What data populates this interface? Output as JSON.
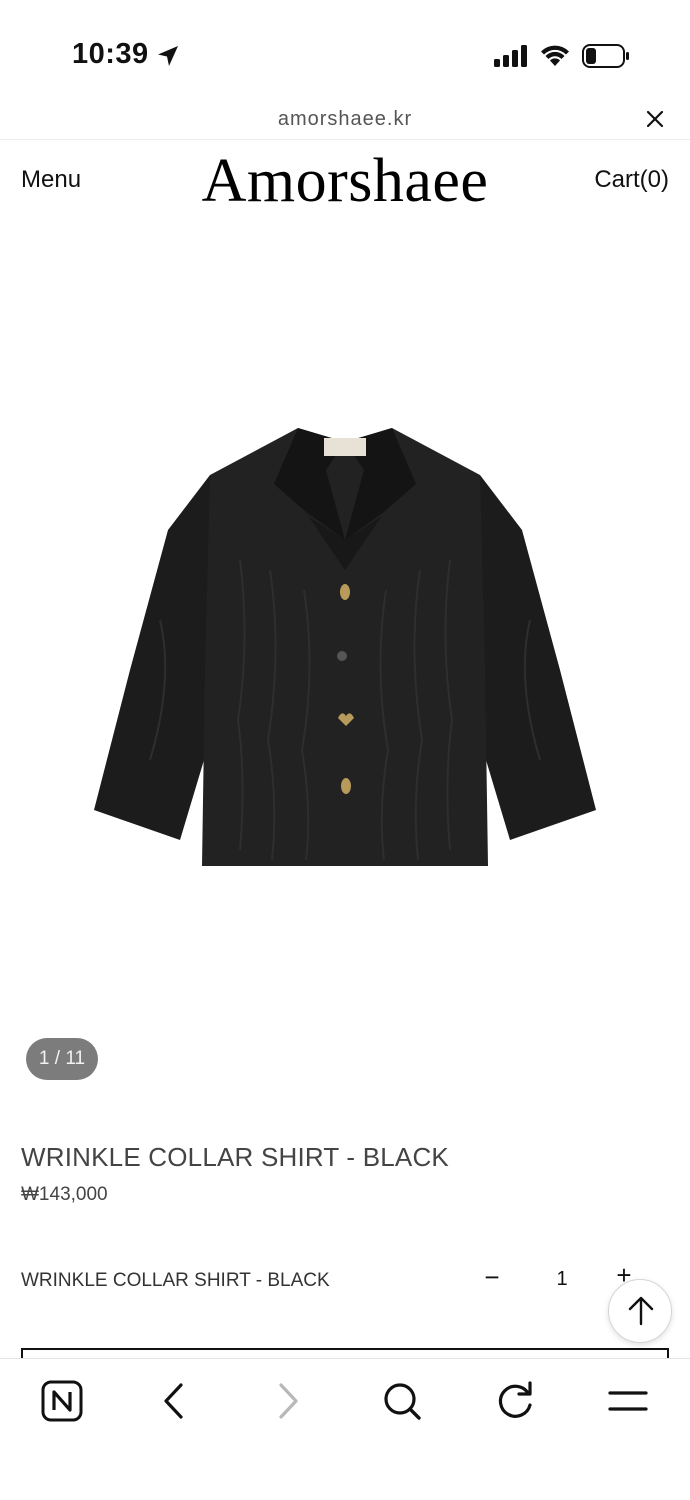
{
  "status_bar": {
    "time": "10:39",
    "icons": [
      "location-arrow-icon",
      "signal-icon",
      "wifi-icon",
      "battery-icon"
    ]
  },
  "url_bar": {
    "url": "amorshaee.kr",
    "close_icon": "close-icon"
  },
  "header": {
    "menu_label": "Menu",
    "logo": "Amorshaee",
    "cart_label": "Cart(0)"
  },
  "gallery": {
    "counter": "1 / 11",
    "image": "black wrinkle collar shirt"
  },
  "product": {
    "title": "WRINKLE COLLAR SHIRT - BLACK",
    "price": "₩143,000"
  },
  "option": {
    "name": "WRINKLE COLLAR SHIRT - BLACK",
    "minus_label": "−",
    "quantity": "1",
    "plus_label": "+"
  },
  "toolbar": {
    "icons": [
      "naver-home-icon",
      "back-icon",
      "forward-icon",
      "search-icon",
      "reload-icon",
      "menu-icon"
    ]
  },
  "colors": {
    "background": "#ffffff",
    "text": "#111111",
    "counter_bg": "#7c7c7c",
    "shirt": "#1c1c1c"
  }
}
